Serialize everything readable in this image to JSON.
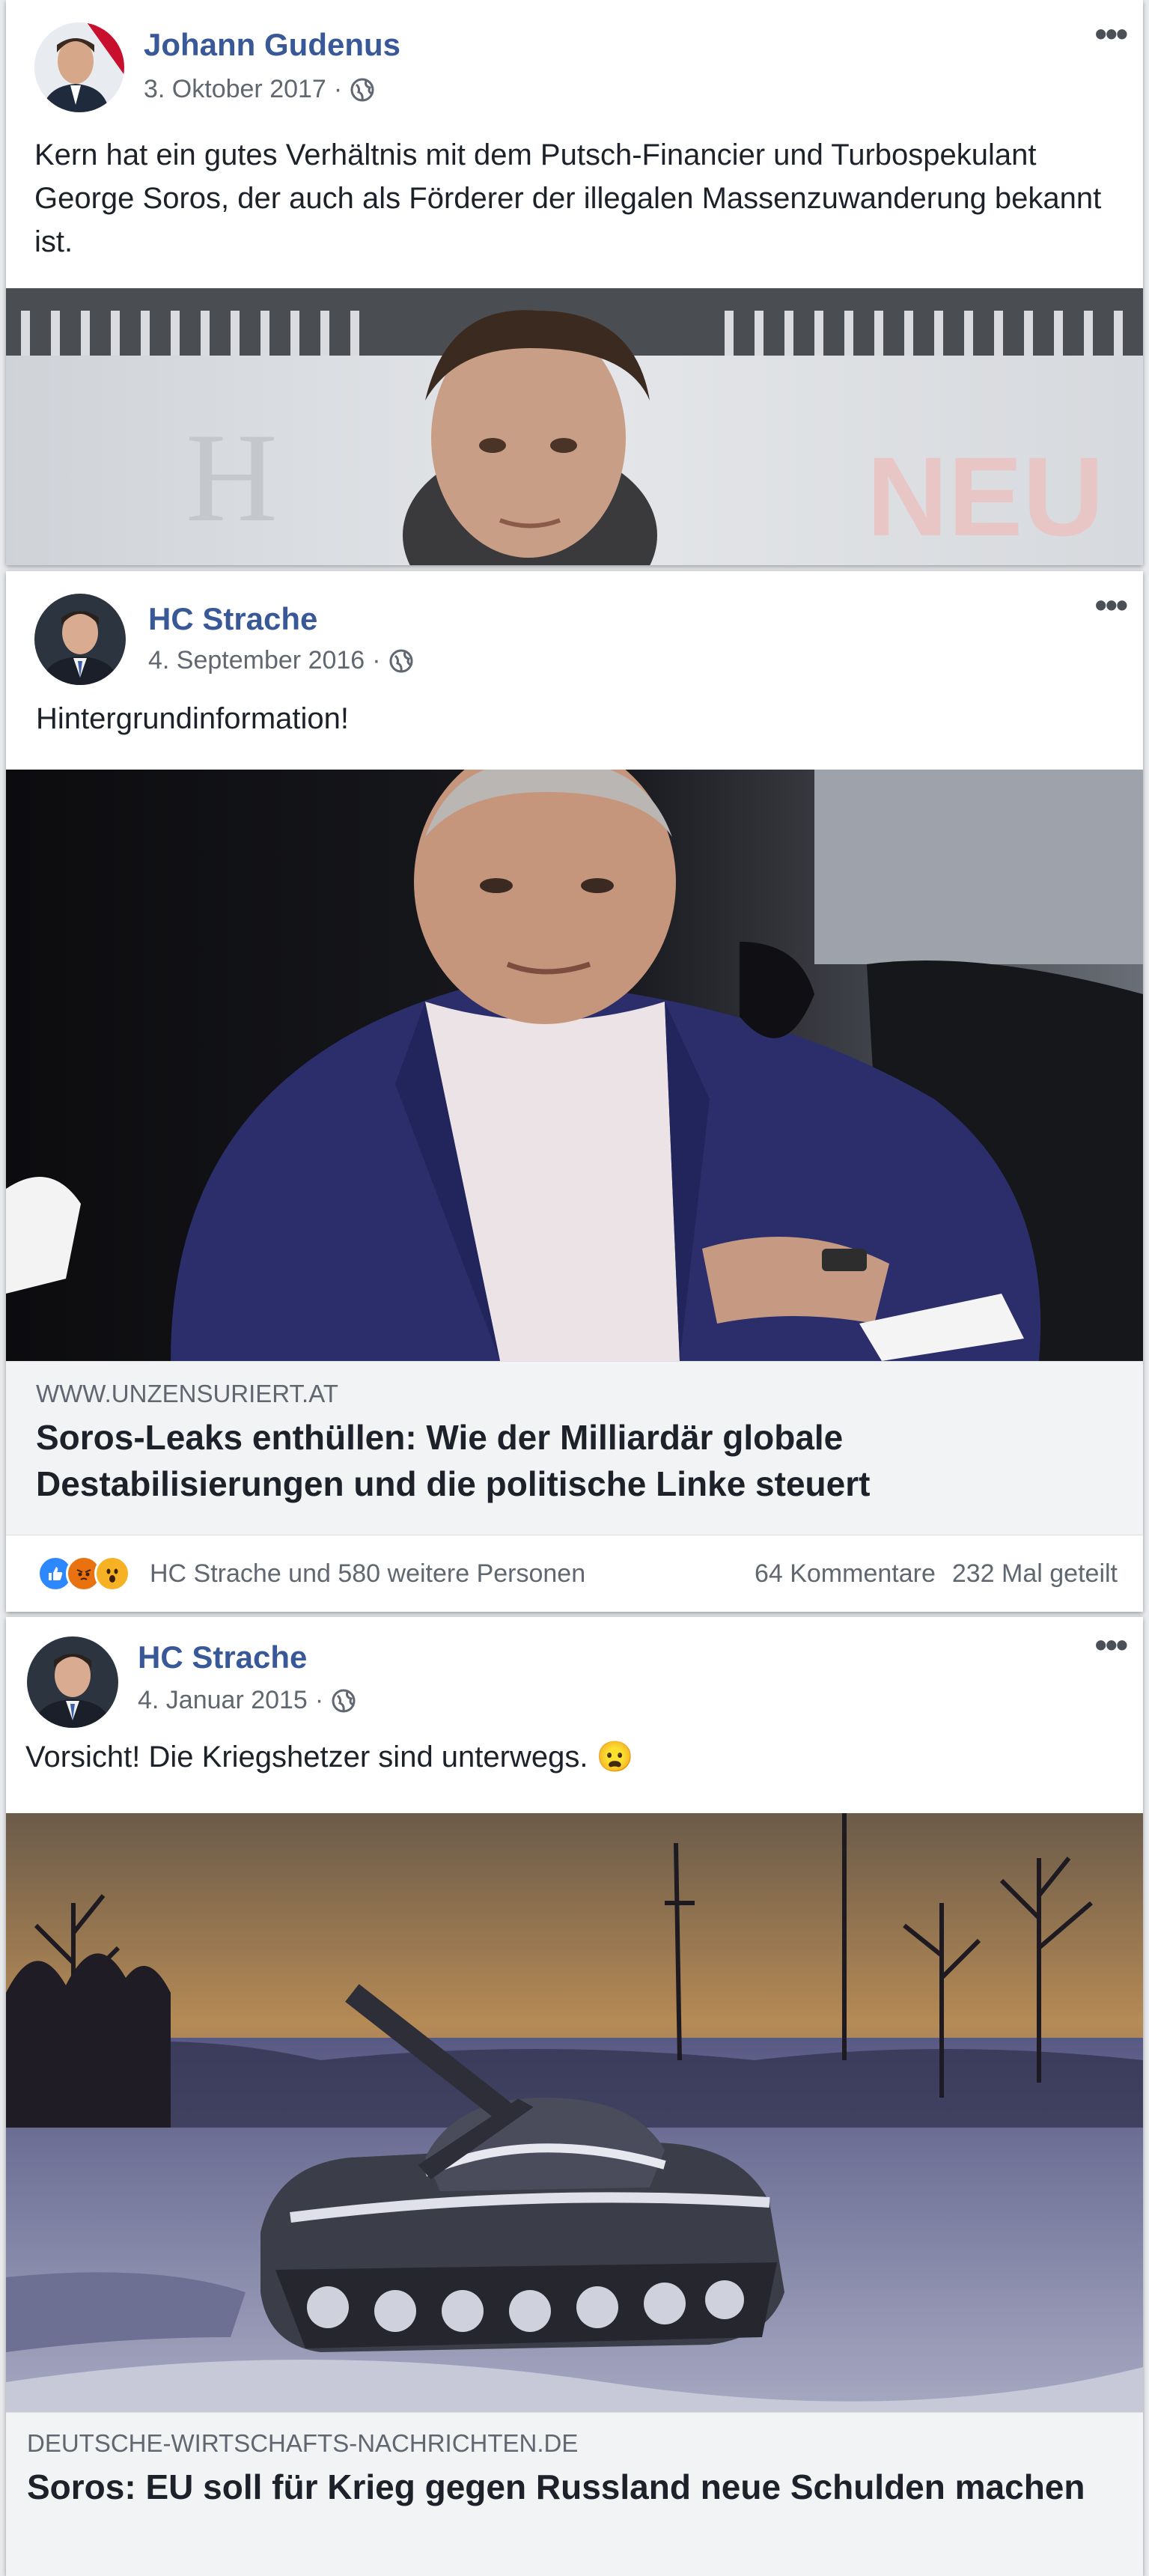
{
  "posts": [
    {
      "author": "Johann Gudenus",
      "date": "3. Oktober 2017",
      "separator": "·",
      "more": "•••",
      "text": "Kern hat ein gutes Verhältnis mit dem Putsch-Financier und Turbospekulant George Soros, der auch als Förderer der illegalen Massenzuwanderung bekannt ist.",
      "photo_sign_letters": [
        "H",
        "NEU"
      ]
    },
    {
      "author": "HC Strache",
      "date": "4. September 2016",
      "separator": "·",
      "more": "•••",
      "text": "Hintergrundinformation!",
      "link": {
        "domain": "WWW.UNZENSURIERT.AT",
        "title": "Soros-Leaks enthüllen: Wie der Milliardär globale Destabilisierungen und die politische Linke steuert"
      },
      "reactions": {
        "icons": [
          "like",
          "angry",
          "wow"
        ],
        "people": "HC Strache und 580 weitere Personen",
        "comments": "64 Kommentare",
        "shares": "232 Mal geteilt"
      }
    },
    {
      "author": "HC Strache",
      "date": "4. Januar 2015",
      "separator": "·",
      "more": "•••",
      "text": "Vorsicht! Die Kriegshetzer sind unterwegs.",
      "emoji": "😦",
      "link": {
        "domain": "DEUTSCHE-WIRTSCHAFTS-NACHRICHTEN.DE",
        "title": "Soros: EU soll für Krieg gegen Russland neue Schulden machen"
      }
    }
  ],
  "colors": {
    "author": "#385898",
    "like": "#2d88ff",
    "angry": "#e9710f",
    "wow": "#f7b125"
  }
}
